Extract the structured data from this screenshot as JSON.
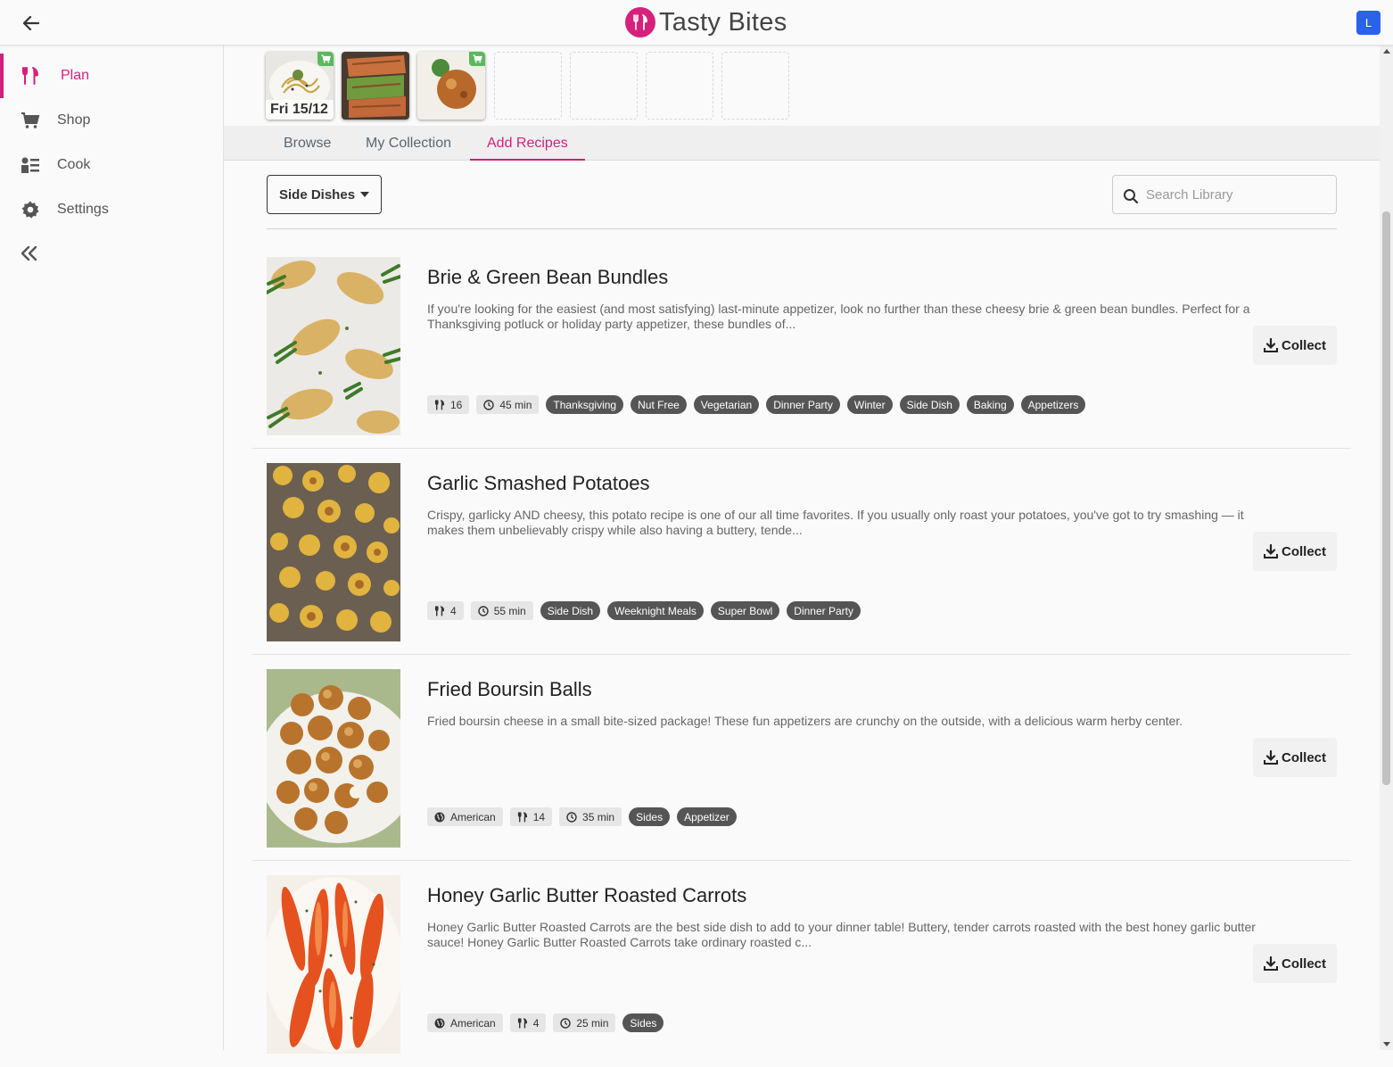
{
  "app": {
    "title": "Tasty Bites",
    "avatar_initial": "L",
    "brand_color": "#d6207c"
  },
  "sidebar": {
    "items": [
      {
        "label": "Plan",
        "icon": "utensils-icon",
        "active": true
      },
      {
        "label": "Shop",
        "icon": "cart-icon"
      },
      {
        "label": "Cook",
        "icon": "cook-icon"
      },
      {
        "label": "Settings",
        "icon": "gear-icon"
      }
    ]
  },
  "plan": {
    "slots": [
      {
        "filled": true,
        "date": "Fri 15/12",
        "in_cart": true,
        "image": "pasta"
      },
      {
        "filled": true,
        "in_cart": false,
        "image": "salmon"
      },
      {
        "filled": true,
        "in_cart": true,
        "image": "boursin"
      },
      {
        "filled": false
      },
      {
        "filled": false
      },
      {
        "filled": false
      },
      {
        "filled": false
      }
    ]
  },
  "tabs": [
    {
      "label": "Browse"
    },
    {
      "label": "My Collection"
    },
    {
      "label": "Add Recipes",
      "active": true
    }
  ],
  "filter": {
    "category": "Side Dishes",
    "search_placeholder": "Search Library"
  },
  "collect_label": "Collect",
  "recipes": [
    {
      "title": "Brie & Green Bean Bundles",
      "description": "If you're looking for the easiest (and most satisfying) last-minute appetizer, look no further than these cheesy brie & green bean bundles. Perfect for a Thanksgiving potluck or holiday party appetizer, these bundles of...",
      "servings": "16",
      "time": "45 min",
      "tags": [
        "Thanksgiving",
        "Nut Free",
        "Vegetarian",
        "Dinner Party",
        "Winter",
        "Side Dish",
        "Baking",
        "Appetizers"
      ]
    },
    {
      "title": "Garlic Smashed Potatoes",
      "description": "Crispy, garlicky AND cheesy, this potato recipe is one of our all time favorites. If you usually only roast your potatoes, you've got to try smashing — it makes them unbelievably crispy while also having a buttery, tende...",
      "servings": "4",
      "time": "55 min",
      "tags": [
        "Side Dish",
        "Weeknight Meals",
        "Super Bowl",
        "Dinner Party"
      ]
    },
    {
      "title": "Fried Boursin Balls",
      "description": "Fried boursin cheese in a small bite-sized package! These fun appetizers are crunchy on the outside, with a delicious warm herby center.",
      "cuisine": "American",
      "servings": "14",
      "time": "35 min",
      "tags": [
        "Sides",
        "Appetizer"
      ]
    },
    {
      "title": "Honey Garlic Butter Roasted Carrots",
      "description": "Honey Garlic Butter Roasted Carrots are the best side dish to add to your dinner table! Buttery, tender carrots roasted with the best honey garlic butter sauce! Honey Garlic Butter Roasted Carrots take ordinary roasted c...",
      "cuisine": "American",
      "servings": "4",
      "time": "25 min",
      "tags": [
        "Sides"
      ]
    }
  ]
}
